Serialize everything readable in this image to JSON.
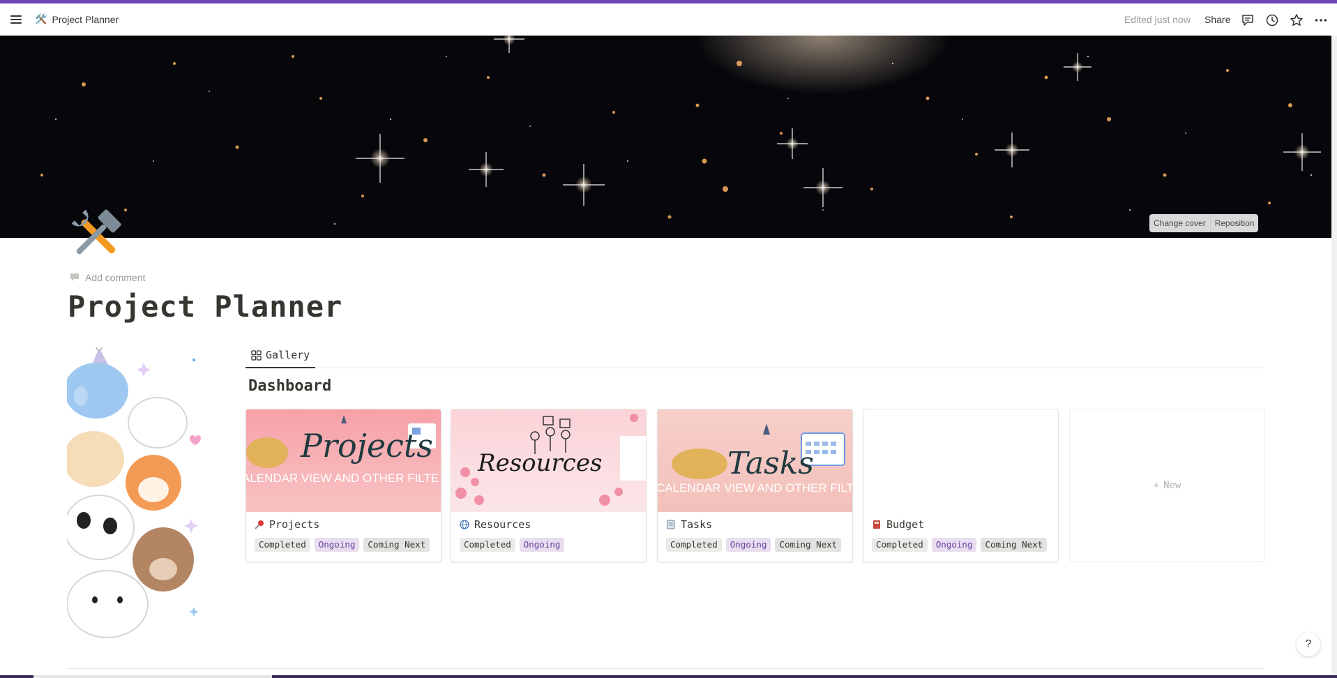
{
  "topbar": {
    "breadcrumb_emoji": "🛠️",
    "breadcrumb_title": "Project Planner",
    "edited": "Edited just now",
    "share": "Share"
  },
  "cover": {
    "change_cover": "Change cover",
    "reposition": "Reposition"
  },
  "page": {
    "add_comment": "Add comment",
    "title": "Project Planner"
  },
  "view": {
    "tab_label": "Gallery",
    "dashboard_title": "Dashboard"
  },
  "cards": [
    {
      "name": "Projects",
      "icon": "pushpin-icon",
      "thumb_title": "Projects",
      "thumb_subtitle": "ALENDAR VIEW AND OTHER FILTE",
      "tags": [
        "Completed",
        "Ongoing",
        "Coming Next"
      ]
    },
    {
      "name": "Resources",
      "icon": "globe-icon",
      "thumb_title": "Resources",
      "tags": [
        "Completed",
        "Ongoing"
      ]
    },
    {
      "name": "Tasks",
      "icon": "notepad-icon",
      "thumb_title": "Tasks",
      "thumb_subtitle": "CALENDAR VIEW AND OTHER FILTE",
      "tags": [
        "Completed",
        "Ongoing",
        "Coming Next"
      ]
    },
    {
      "name": "Budget",
      "icon": "ledger-icon",
      "tags": [
        "Completed",
        "Ongoing",
        "Coming Next"
      ]
    }
  ],
  "new_card": {
    "label": "New"
  },
  "help": "?",
  "colors": {
    "accent_strip": "#6f42b8",
    "ongoing_tag_bg": "#e8deee",
    "ongoing_tag_text": "#6940a5",
    "completed_tag_bg": "#ebeae8"
  }
}
